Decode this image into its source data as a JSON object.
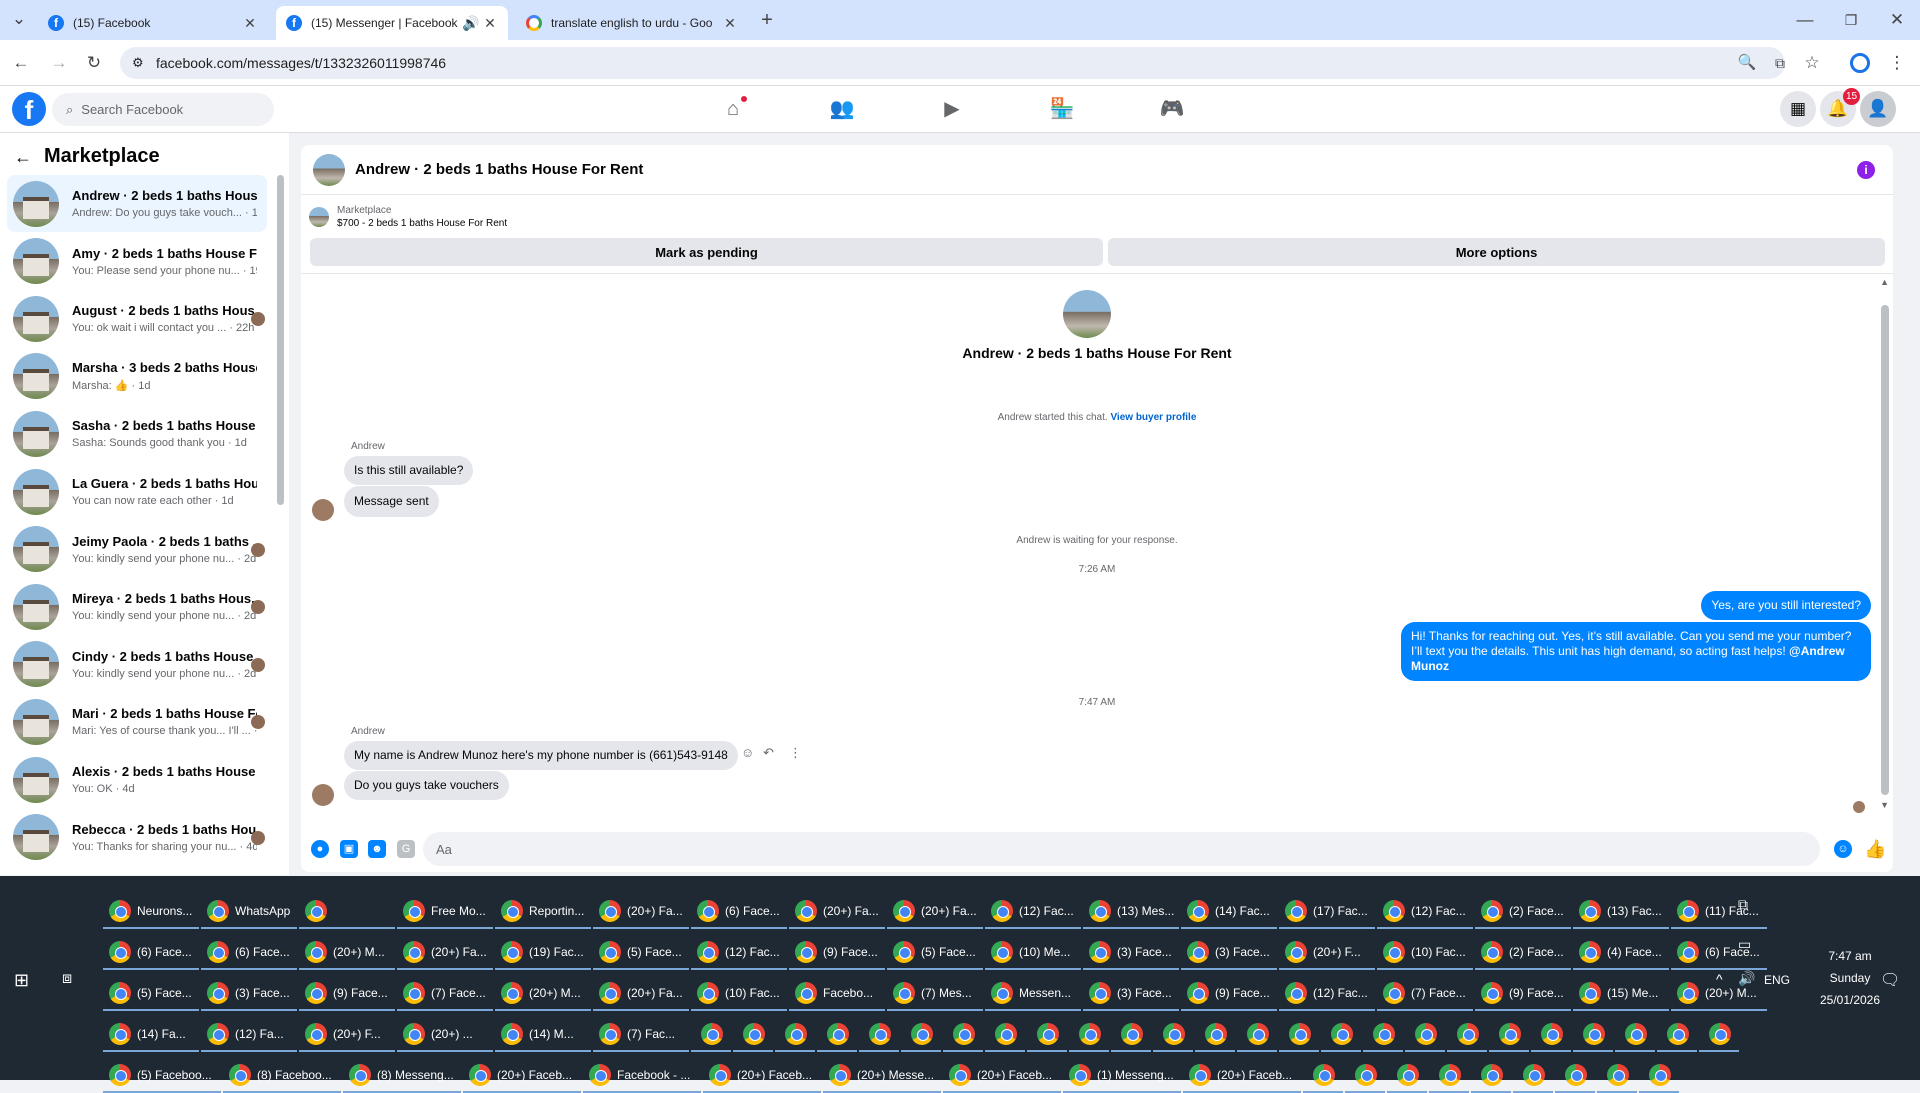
{
  "browser": {
    "tabs": [
      {
        "title": "(15) Facebook",
        "icon": "facebook-icon"
      },
      {
        "title": "(15) Messenger | Facebook",
        "icon": "facebook-icon",
        "active": true
      },
      {
        "title": "translate english to urdu - Goo",
        "icon": "google-icon"
      }
    ],
    "url": "facebook.com/messages/t/1332326011998746"
  },
  "fb": {
    "search_placeholder": "Search Facebook",
    "notif_count": "15"
  },
  "sidebar": {
    "title": "Marketplace",
    "conversations": [
      {
        "name": "Andrew · 2 beds 1 baths House ...",
        "preview": "Andrew: Do you guys take vouch... · 1m"
      },
      {
        "name": "Amy · 2 beds 1 baths House For ...",
        "preview": "You: Please send your phone nu... · 19m"
      },
      {
        "name": "August · 2 beds 1 baths Hous...",
        "preview": "You: ok wait i will contact you ... · 22h"
      },
      {
        "name": "Marsha · 3 beds 2 baths House ...",
        "preview": "Marsha: 👍 · 1d"
      },
      {
        "name": "Sasha · 2 beds 1 baths House Fo...",
        "preview": "Sasha: Sounds good thank you · 1d"
      },
      {
        "name": "La Guera · 2 beds 1 baths House...",
        "preview": "You can now rate each other · 1d"
      },
      {
        "name": "Jeimy Paola · 2 beds 1 baths ...",
        "preview": "You: kindly send your phone nu... · 2d"
      },
      {
        "name": "Mireya · 2 beds 1 baths Hous...",
        "preview": "You: kindly send your phone nu... · 2d"
      },
      {
        "name": "Cindy · 2 beds 1 baths House ...",
        "preview": "You: kindly send your phone nu... · 2d"
      },
      {
        "name": "Mari · 2 beds 1 baths House For...",
        "preview": "Mari: Yes of course thank you... I'll ... · 3d"
      },
      {
        "name": "Alexis · 2 beds 1 baths House Fo...",
        "preview": "You: OK · 4d"
      },
      {
        "name": "Rebecca · 2 beds 1 baths Hou...",
        "preview": "You: Thanks for sharing your nu... · 4d"
      }
    ]
  },
  "chat": {
    "title": "Andrew · 2 beds 1 baths House For Rent",
    "listing_label": "Marketplace",
    "listing_price": "$700 - 2 beds 1 baths House For Rent",
    "mark_pending": "Mark as pending",
    "more_options": "More options",
    "started_text": "Andrew started this chat.",
    "view_profile": "View buyer profile",
    "sender": "Andrew",
    "msg1": "Is this still available?",
    "msg2": "Message sent",
    "waiting": "Andrew is waiting for your response.",
    "time1": "7:26 AM",
    "my1": "Yes, are you still interested?",
    "my2": "Hi! Thanks for reaching out. Yes, it’s still available. Can you send me your number? I’ll text you the details. This unit has high demand, so acting fast helps!",
    "my2_mention": "@Andrew Munoz",
    "time2": "7:47 AM",
    "msg3": "My name is Andrew Munoz here's my phone number is (661)543-9148",
    "msg4": "Do you guys take vouchers",
    "composer_placeholder": "Aa"
  },
  "taskbar": {
    "row1": [
      "Neurons...",
      "WhatsApp",
      "",
      "Free Mo...",
      "Reportin...",
      "(20+) Fa...",
      "(6) Face...",
      "(20+) Fa...",
      "(20+) Fa...",
      "(12) Fac...",
      "(13) Mes...",
      "(14) Fac...",
      "(17) Fac...",
      "(12) Fac...",
      "(2) Face...",
      "(13) Fac...",
      "(11) Fac..."
    ],
    "row2": [
      "(6) Face...",
      "(6) Face...",
      "(20+) M...",
      "(20+) Fa...",
      "(19) Fac...",
      "(5) Face...",
      "(12) Fac...",
      "(9) Face...",
      "(5) Face...",
      "(10) Me...",
      "(3) Face...",
      "(3) Face...",
      "(20+) F...",
      "(10) Fac...",
      "(2) Face...",
      "(4) Face...",
      "(6) Face..."
    ],
    "row3": [
      "(5) Face...",
      "(3) Face...",
      "(9) Face...",
      "(7) Face...",
      "(20+) M...",
      "(20+) Fa...",
      "(10) Fac...",
      "Facebo...",
      "(7) Mes...",
      "Messen...",
      "(3) Face...",
      "(9) Face...",
      "(12) Fac...",
      "(7) Face...",
      "(9) Face...",
      "(15) Me...",
      "(20+) M..."
    ],
    "row4": [
      "(14) Fa...",
      "(12) Fa...",
      "(20+) F...",
      "(20+) ...",
      "(14) M...",
      "(7) Fac..."
    ],
    "row5": [
      "(5) Faceboo...",
      "(8) Faceboo...",
      "(8) Messeng...",
      "(20+) Faceb...",
      "Facebook - ...",
      "(20+) Faceb...",
      "(20+) Messe...",
      "(20+) Faceb...",
      "(1) Messeng...",
      "(20+) Faceb..."
    ],
    "time": "7:47 am",
    "day": "Sunday",
    "date": "25/01/2026",
    "lang": "ENG"
  }
}
